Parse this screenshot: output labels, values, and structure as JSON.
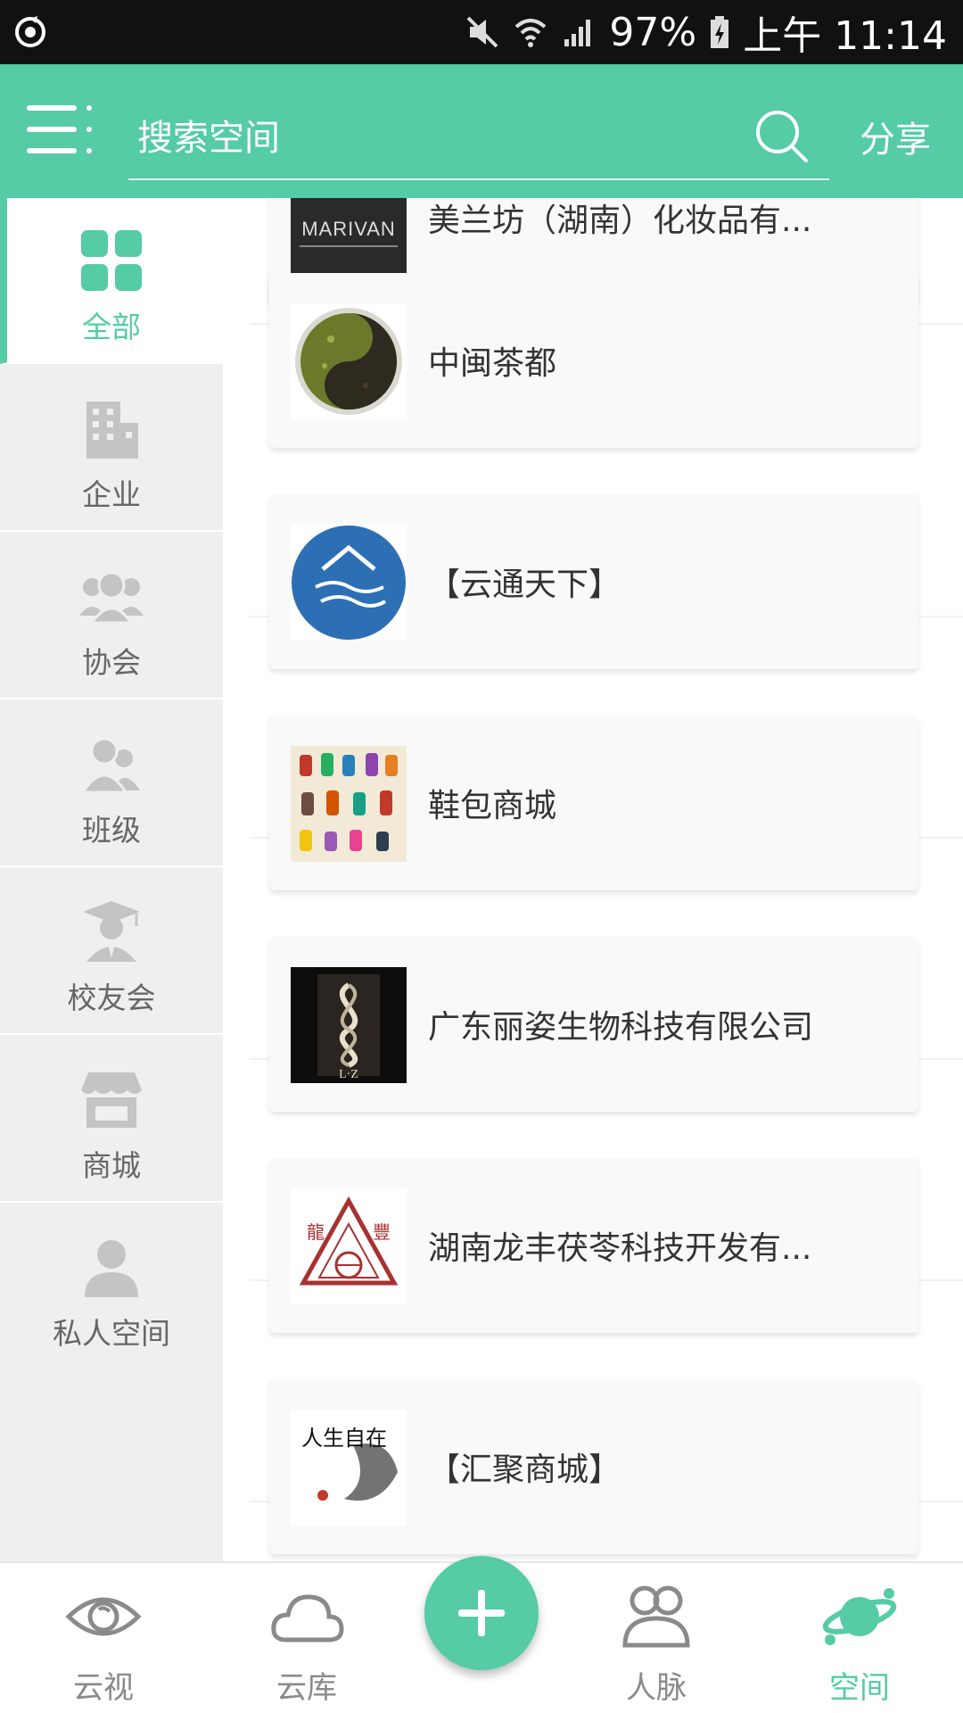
{
  "status_bar": {
    "battery": "97%",
    "time": "上午 11:14"
  },
  "header": {
    "search_placeholder": "搜索空间",
    "share_label": "分享"
  },
  "sidebar": {
    "items": [
      {
        "label": "全部",
        "icon": "grid-icon",
        "active": true
      },
      {
        "label": "企业",
        "icon": "building-icon",
        "active": false
      },
      {
        "label": "协会",
        "icon": "group-icon",
        "active": false
      },
      {
        "label": "班级",
        "icon": "people-icon",
        "active": false
      },
      {
        "label": "校友会",
        "icon": "graduate-icon",
        "active": false
      },
      {
        "label": "商城",
        "icon": "shop-icon",
        "active": false
      },
      {
        "label": "私人空间",
        "icon": "person-icon",
        "active": false
      }
    ]
  },
  "list": {
    "items": [
      {
        "title": "美兰坊（湖南）化妆品有...",
        "thumb": "marivan-logo",
        "thumb_text": "MARIVAN"
      },
      {
        "title": "中闽茶都",
        "thumb": "tea-image"
      },
      {
        "title": "【云通天下】",
        "thumb": "cloud-house-logo"
      },
      {
        "title": "鞋包商城",
        "thumb": "shoes-image"
      },
      {
        "title": "广东丽姿生物科技有限公司",
        "thumb": "lz-logo",
        "thumb_text": "L·Z"
      },
      {
        "title": "湖南龙丰茯苓科技开发有...",
        "thumb": "longfeng-logo",
        "thumb_text": [
          "龍",
          "豐"
        ]
      },
      {
        "title": "【汇聚商城】",
        "thumb": "calligraphy-image",
        "thumb_text": "人生自在"
      }
    ]
  },
  "bottom_nav": {
    "items": [
      {
        "label": "云视",
        "icon": "eye-icon",
        "active": false
      },
      {
        "label": "云库",
        "icon": "cloud-icon",
        "active": false
      },
      {
        "label": "人脉",
        "icon": "contacts-icon",
        "active": false
      },
      {
        "label": "空间",
        "icon": "planet-icon",
        "active": true
      }
    ],
    "add_button": "plus-icon"
  },
  "colors": {
    "accent": "#55cba6",
    "status_bar": "#111111",
    "sidebar_bg": "#efefef",
    "inactive_text": "#8a8a8a"
  }
}
